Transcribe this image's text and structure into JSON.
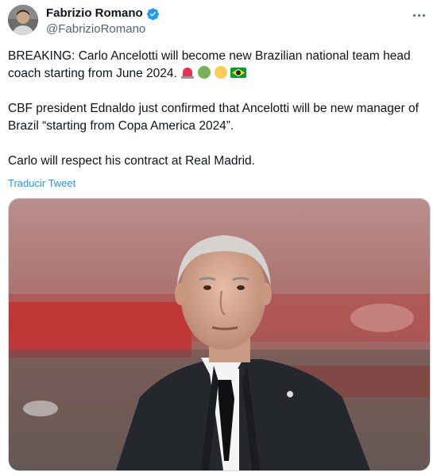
{
  "author": {
    "display_name": "Fabrizio Romano",
    "handle": "@FabrizioRomano",
    "verified": true
  },
  "tweet": {
    "paragraphs": [
      "BREAKING: Carlo Ancelotti will become new Brazilian national team head coach starting from June 2024.",
      "CBF president Ednaldo just confirmed that Ancelotti will be new manager of Brazil “starting from Copa America 2024”.",
      "Carlo will respect his contract at Real Madrid."
    ],
    "emojis": [
      "siren-icon",
      "green-circle-icon",
      "yellow-circle-icon",
      "brazil-flag-icon"
    ],
    "translate_label": "Traducir Tweet"
  },
  "colors": {
    "link": "#1d9bf0",
    "verified": "#1d9bf0",
    "secondary_text": "#536471"
  }
}
